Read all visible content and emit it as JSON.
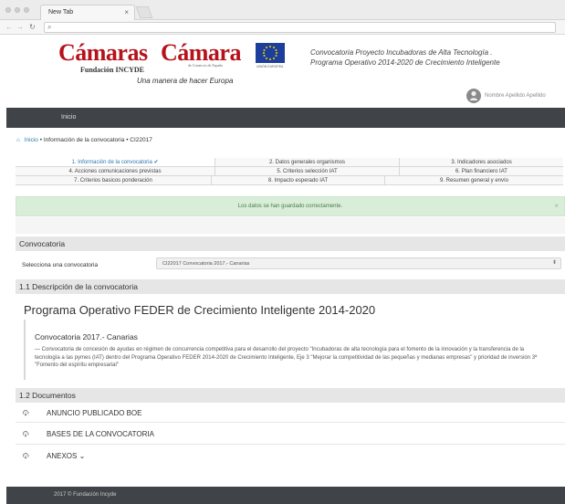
{
  "browser": {
    "tab_title": "New Tab",
    "tab_close": "×",
    "url": ""
  },
  "header": {
    "logo1_main": "Cámaras",
    "logo1_sub": "Fundación INCYDE",
    "logo2_main": "Cámara",
    "logo2_sub": "de Comercio de España",
    "eu_caption": "UNIÓN EUROPEA",
    "slogan": "Una manera de hacer Europa",
    "title_line1": "Convocatoria Proyecto Incubadoras de Alta Tecnología .",
    "title_line2": "Programa Operativo 2014-2020 de Crecimiento Inteligente",
    "user_name": "Nombre Apellido Apellido"
  },
  "nav": {
    "home": "Inicio"
  },
  "breadcrumb": {
    "home": "Inicio",
    "sep": "•",
    "page": "Información de la convocatoria",
    "code": "CI22017"
  },
  "steps": {
    "row1": [
      "1. Información de la convocatoria ✔",
      "2. Datos generales organismos",
      "3. Indicadores asociados"
    ],
    "row2": [
      "4. Acciones comunicaciones previstas",
      "5. Criterios selección IAT",
      "6. Plan financiero IAT"
    ],
    "row3": [
      "7. Criterios basicos ponderación",
      "8. Impacto esperado IAT",
      "9. Resumen general y envío"
    ]
  },
  "alert": {
    "message": "Los datos se han guardado correctamente.",
    "close": "×"
  },
  "convocatoria": {
    "section_title": "Convocatoria",
    "select_label": "Selecciona una convocatoria",
    "select_value": "CI22017 Convocatoria 2017.- Canarias",
    "select_caret": "⬍"
  },
  "description": {
    "section_title": "1.1 Descripción de la convocatoria",
    "program_title": "Programa Operativo FEDER de Crecimiento Inteligente 2014-2020",
    "conv_name": "Convocatoria 2017.- Canarias",
    "conv_desc": "— Convocatoria de concesión de ayudas en régimen de concurrencia competitiva para el desarrollo del proyecto \"Incubadoras de alta tecnología para el fomento de la innovación y la transferencia de la tecnología a las pymes (IAT) dentro del Programa Operativo FEDER 2014-2020 de Crecimiento Inteligente, Eje 3 \"Mejorar la competitividad de las pequeñas y medianas empresas\" y prioridad de inversión 3ª \"Fomento del espíritu empresarial\""
  },
  "documents": {
    "section_title": "1.2 Documentos",
    "items": [
      "ANUNCIO PUBLICADO BOE",
      "BASES DE LA CONVOCATORIA",
      "ANEXOS ⌄"
    ]
  },
  "footer": {
    "text": "2017 © Fundación Incyde"
  },
  "colors": {
    "brand_red": "#b5121b",
    "nav_dark": "#404448",
    "link_blue": "#2a7ab0",
    "success_bg": "#d9eed8"
  }
}
